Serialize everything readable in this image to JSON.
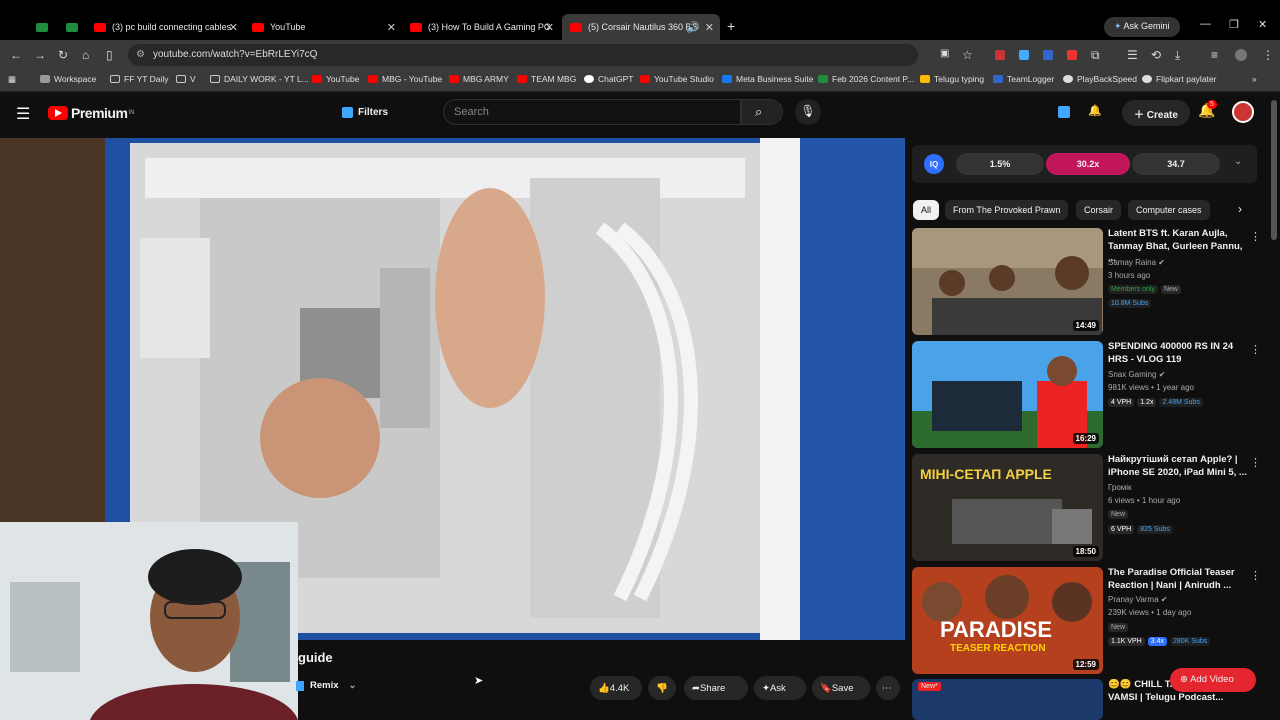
{
  "browser": {
    "tabs": [
      {
        "title": ""
      },
      {
        "title": ""
      },
      {
        "title": "(3) pc build connecting cables"
      },
      {
        "title": "YouTube"
      },
      {
        "title": "(3) How To Build A Gaming PC"
      },
      {
        "title": "(5) Corsair Nautilus 360 RS"
      }
    ],
    "new_tab": "+",
    "ask_gemini": "Ask Gemini",
    "url": "youtube.com/watch?v=EbRrLEYi7cQ",
    "bookmarks": [
      "Workspace",
      "FF YT Daily",
      "V",
      "DAILY WORK - YT L...",
      "YouTube",
      "MBG - YouTube",
      "MBG ARMY",
      "TEAM MBG",
      "ChatGPT",
      "YouTube Studio",
      "Meta Business Suite",
      "Feb 2026 Content P...",
      "Telugu typing",
      "TeamLogger",
      "PlayBackSpeed",
      "Flipkart paylater"
    ]
  },
  "header": {
    "logo": "Premium",
    "logo_sup": "IN",
    "filters": "Filters",
    "search_placeholder": "Search",
    "create": "Create",
    "notif_count": "5"
  },
  "video": {
    "title_fragment": "guide",
    "remix": "Remix",
    "likes": "4.4K",
    "share": "Share",
    "ask": "Ask",
    "save": "Save"
  },
  "stats": {
    "a": "1.5%",
    "b": "30.2x",
    "c": "34.7"
  },
  "chips": [
    "All",
    "From The Provoked Prawn",
    "Corsair",
    "Computer cases"
  ],
  "recommendations": [
    {
      "title": "Latent BTS ft. Karan Aujla, Tanmay Bhat, Gurleen Pannu, ...",
      "channel": "Samay Raina",
      "meta": "3 hours ago",
      "badge1": "Members only",
      "badge2": "New",
      "subs": "10.8M Subs",
      "duration": "14:49"
    },
    {
      "title": "SPENDING 400000 RS IN 24 HRS - VLOG 119",
      "channel": "Snax Gaming",
      "meta": "981K views • 1 year ago",
      "vph": "4 VPH",
      "x": "1.2x",
      "subs": "2.48M Subs",
      "duration": "16:29"
    },
    {
      "title": "Найкрутіший сетап Apple? | iPhone SE 2020, iPad Mini 5, ...",
      "channel": "Громік",
      "meta": "6 views • 1 hour ago",
      "badge2": "New",
      "vph": "6 VPH",
      "subs": "825 Subs",
      "duration": "18:50",
      "thumb_text": "МІНІ-СЕТАП APPLE"
    },
    {
      "title": "The Paradise Official Teaser Reaction | Nani | Anirudh ...",
      "channel": "Pranay Varma",
      "meta": "239K views • 1 day ago",
      "badge2": "New",
      "vph": "1.1K VPH",
      "x": "3.4x",
      "subs": "280K Subs",
      "duration": "12:59",
      "thumb_text": "PARADISE",
      "thumb_sub": "TEASER REACTION"
    },
    {
      "title": "😊😊 CHILL TA... NAGA VAMSI | Telugu Podcast...",
      "thumb_badge": "New*"
    }
  ],
  "add_video": "Add Video"
}
